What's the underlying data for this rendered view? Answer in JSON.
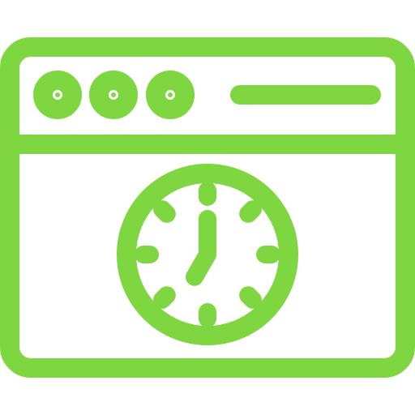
{
  "icon": {
    "name": "browser-window-clock-icon",
    "color": "#7ED640",
    "background": "#ffffff",
    "parts": [
      "window-frame",
      "title-bar",
      "window-control-dots",
      "address-bar",
      "clock-icon"
    ],
    "clock": {
      "hour_hand_points_to": 7,
      "minute_hand_points_to": 12
    }
  }
}
